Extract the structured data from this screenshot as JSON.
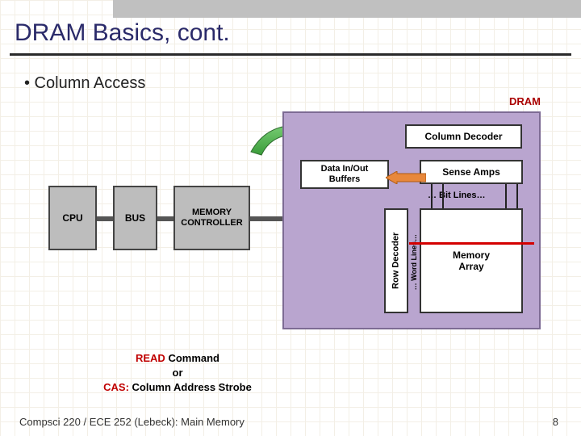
{
  "slide": {
    "title": "DRAM Basics, cont.",
    "bullet": "•  Column Access",
    "footer": "Compsci 220 / ECE 252 (Lebeck): Main Memory",
    "page_number": "8"
  },
  "diagram": {
    "blocks": {
      "cpu": "CPU",
      "bus": "BUS",
      "memory_controller": "MEMORY\nCONTROLLER",
      "dram_label": "DRAM",
      "column_decoder": "Column Decoder",
      "data_buffers": "Data In/Out\nBuffers",
      "sense_amps": "Sense Amps",
      "bit_lines": "… Bit Lines…",
      "row_decoder": "Row Decoder",
      "word_lines": "… Word Lines…",
      "memory_array": "Memory\nArray"
    },
    "caption": {
      "read_red": "READ",
      "read_rest": " Command",
      "or": "or",
      "cas_red": "CAS:",
      "cas_rest": " Column Address Strobe"
    },
    "arrows": {
      "green": "column-address-arrow",
      "orange": "sense-to-buffer-arrow"
    }
  }
}
